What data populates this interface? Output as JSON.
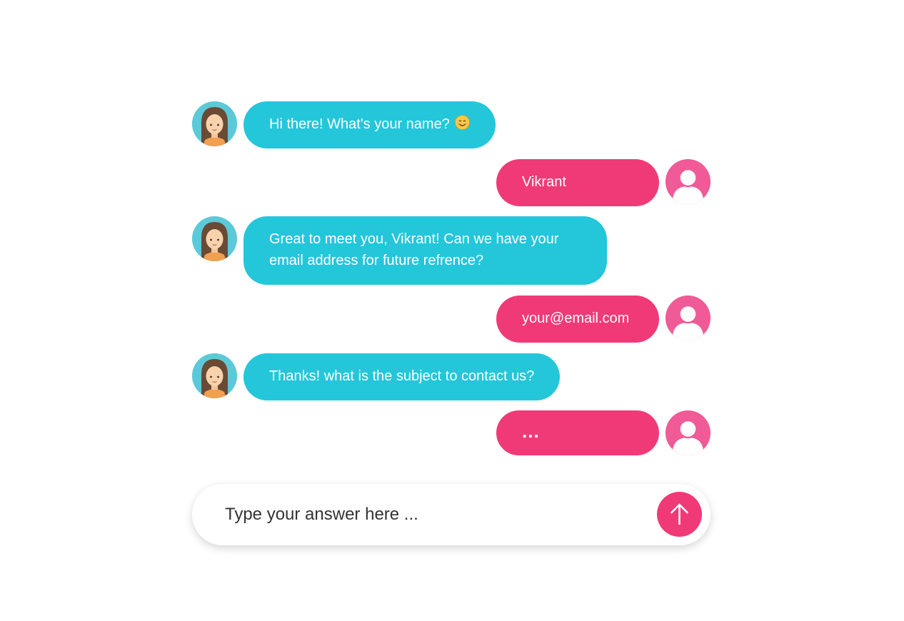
{
  "colors": {
    "bot_bubble": "#24c6da",
    "user_bubble": "#f03a77",
    "bot_avatar_bg": "#5cc9d8",
    "user_avatar_bg": "#f05a97",
    "send_button": "#f03a77"
  },
  "messages": [
    {
      "sender": "bot",
      "text": "Hi there! What's your name?",
      "emoji": "smiling-face-icon"
    },
    {
      "sender": "user",
      "text": "Vikrant"
    },
    {
      "sender": "bot",
      "text": "Great to meet you, Vikrant! Can we have your email address for future refrence?"
    },
    {
      "sender": "user",
      "text": "your@email.com"
    },
    {
      "sender": "bot",
      "text": "Thanks! what is the subject to contact us?"
    },
    {
      "sender": "user",
      "text": "..."
    }
  ],
  "composer": {
    "placeholder": "Type your answer here ...",
    "value": "",
    "send_icon": "arrow-up-icon"
  }
}
